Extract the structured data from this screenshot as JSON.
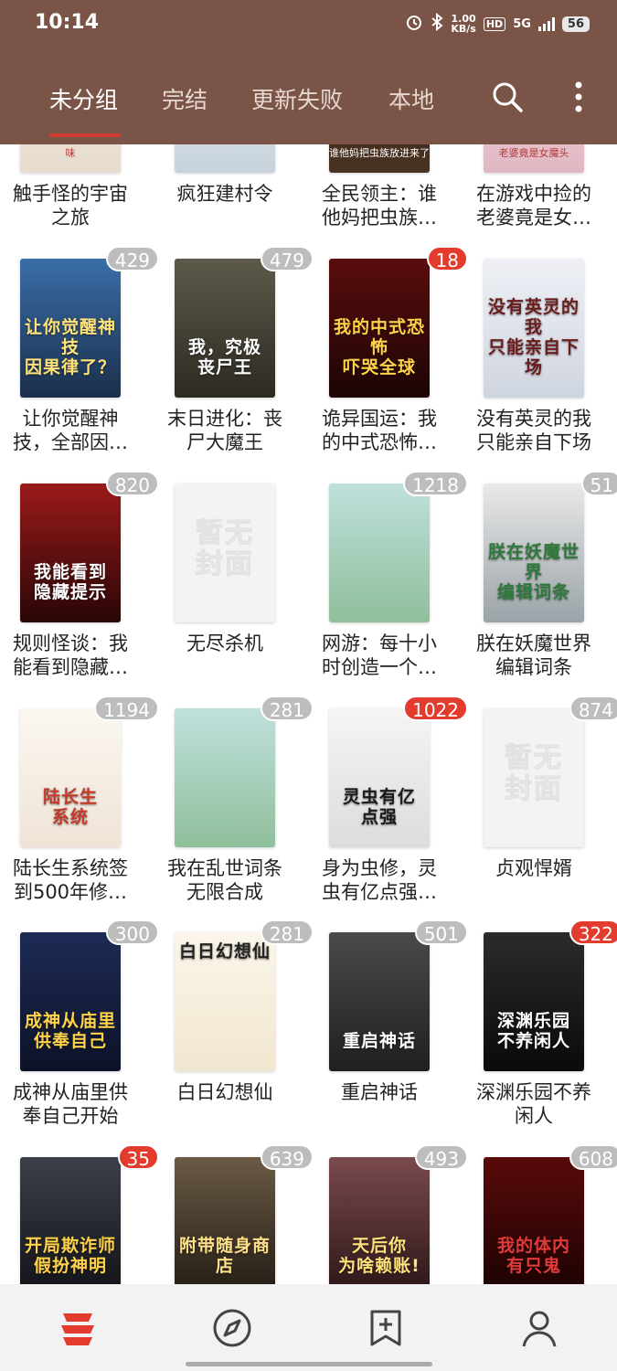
{
  "status": {
    "time": "10:14",
    "speed_top": "1.00",
    "speed_bottom": "KB/s",
    "hd": "HD",
    "network": "5G",
    "battery": "56"
  },
  "tabs": [
    {
      "label": "未分组",
      "active": true
    },
    {
      "label": "完结",
      "active": false
    },
    {
      "label": "更新失败",
      "active": false
    },
    {
      "label": "本地",
      "active": false
    }
  ],
  "header_icons": [
    "search-icon",
    "more-vertical-icon"
  ],
  "nocover_text": [
    "暂无",
    "封面"
  ],
  "books": [
    {
      "title": [
        "触手怪的宇宙",
        "之旅"
      ],
      "badge": null,
      "cover_small": "味",
      "colors": [
        "#f4ece3",
        "#e7dccd"
      ]
    },
    {
      "title": [
        "疯狂建村令"
      ],
      "badge": null,
      "colors": [
        "#e9edf1",
        "#c7d2dc"
      ]
    },
    {
      "title": [
        "全民领主：谁",
        "他妈把虫族…"
      ],
      "badge": null,
      "cover_small": "谁他妈把虫族放进来了",
      "colors": [
        "#2b1d14",
        "#4a3322"
      ]
    },
    {
      "title": [
        "在游戏中捡的",
        "老婆竟是女…"
      ],
      "badge": null,
      "cover_small": "老婆竟是女魔头",
      "colors": [
        "#f3e3e6",
        "#e0b7c2"
      ]
    },
    {
      "title": [
        "让你觉醒神",
        "技，全部因…"
      ],
      "badge": "429",
      "badge_red": false,
      "cover_text": [
        "让你觉醒神技",
        "因果律了？"
      ],
      "colors": [
        "#3a6ea8",
        "#1b2f4c"
      ],
      "text_color": "#ffe27a"
    },
    {
      "title": [
        "末日进化：丧",
        "尸大魔王"
      ],
      "badge": "479",
      "badge_red": false,
      "cover_text": [
        "我，究极",
        "丧尸王"
      ],
      "colors": [
        "#5d5a4a",
        "#2c2a22"
      ],
      "text_color": "#ffffff"
    },
    {
      "title": [
        "诡异国运：我",
        "的中式恐怖…"
      ],
      "badge": "18",
      "badge_red": true,
      "cover_text": [
        "我的中式恐怖",
        "吓哭全球"
      ],
      "colors": [
        "#5a0d0d",
        "#1c0505"
      ],
      "text_color": "#ffd24a"
    },
    {
      "title": [
        "没有英灵的我",
        "只能亲自下场"
      ],
      "badge": null,
      "cover_text": [
        "没有英灵的我",
        "只能亲自下场"
      ],
      "colors": [
        "#eef0f5",
        "#cfd5df"
      ],
      "text_color": "#6b1c1c"
    },
    {
      "title": [
        "规则怪谈：我",
        "能看到隐藏…"
      ],
      "badge": "820",
      "badge_red": false,
      "cover_text": [
        "我能看到",
        "隐藏提示"
      ],
      "colors": [
        "#9b1a1a",
        "#2a0606"
      ],
      "text_color": "#ffffff"
    },
    {
      "title": [
        "无尽杀机"
      ],
      "badge": null,
      "nocover": true,
      "colors": [
        "#f3f3f3",
        "#f3f3f3"
      ]
    },
    {
      "title": [
        "网游：每十小",
        "时创造一个…"
      ],
      "badge": "1218",
      "badge_red": false,
      "colors": [
        "#bfe0dc",
        "#8fbf9b"
      ]
    },
    {
      "title": [
        "朕在妖魔世界",
        "编辑词条"
      ],
      "badge": "51",
      "badge_red": false,
      "cover_text": [
        "朕在妖魔世界",
        "编辑词条"
      ],
      "colors": [
        "#e9e9e9",
        "#9aa3a8"
      ],
      "text_color": "#2e7a3a"
    },
    {
      "title": [
        "陆长生系统签",
        "到500年修…"
      ],
      "badge": "1194",
      "badge_red": false,
      "cover_text": [
        "陆长生",
        "系统"
      ],
      "colors": [
        "#fbf7f1",
        "#efe4d6"
      ],
      "text_color": "#c43a2a"
    },
    {
      "title": [
        "我在乱世词条",
        "无限合成"
      ],
      "badge": "281",
      "badge_red": false,
      "colors": [
        "#bfe0dc",
        "#8fbf9b"
      ]
    },
    {
      "title": [
        "身为虫修，灵",
        "虫有亿点强…"
      ],
      "badge": "1022",
      "badge_red": true,
      "cover_text": [
        "灵虫有亿",
        "点强"
      ],
      "colors": [
        "#f5f5f5",
        "#dcdcdc"
      ],
      "text_color": "#1a1a1a"
    },
    {
      "title": [
        "贞观悍婿"
      ],
      "badge": "874",
      "badge_red": false,
      "nocover": true,
      "colors": [
        "#f3f3f3",
        "#f3f3f3"
      ]
    },
    {
      "title": [
        "成神从庙里供",
        "奉自己开始"
      ],
      "badge": "300",
      "badge_red": false,
      "cover_text": [
        "成神从庙里",
        "供奉自己"
      ],
      "colors": [
        "#1d2b55",
        "#0c1228"
      ],
      "text_color": "#ffd34a"
    },
    {
      "title": [
        "白日幻想仙"
      ],
      "badge": "281",
      "badge_red": false,
      "cover_text": [
        "白日幻想仙"
      ],
      "colors": [
        "#fbf6ea",
        "#f1e6cf"
      ],
      "text_color": "#222222",
      "text_top": true
    },
    {
      "title": [
        "重启神话"
      ],
      "badge": "501",
      "badge_red": false,
      "cover_text": [
        "重启神话"
      ],
      "colors": [
        "#4a4a4a",
        "#1f1f1f"
      ],
      "text_color": "#ffffff"
    },
    {
      "title": [
        "深渊乐园不养",
        "闲人"
      ],
      "badge": "322",
      "badge_red": true,
      "cover_text": [
        "深渊乐园",
        "不养闲人"
      ],
      "colors": [
        "#2b2b2b",
        "#0a0a0a"
      ],
      "text_color": "#ffffff"
    },
    {
      "title": [
        ""
      ],
      "badge": "35",
      "badge_red": true,
      "cover_text": [
        "开局欺诈师",
        "假扮神明"
      ],
      "colors": [
        "#3b3f48",
        "#121318"
      ],
      "text_color": "#ffd24a"
    },
    {
      "title": [
        ""
      ],
      "badge": "639",
      "badge_red": false,
      "cover_text": [
        "附带随身商店"
      ],
      "colors": [
        "#6a5a45",
        "#221c14"
      ],
      "text_color": "#ffe08a"
    },
    {
      "title": [
        ""
      ],
      "badge": "493",
      "badge_red": false,
      "cover_text": [
        "天后你",
        "为啥赖账!"
      ],
      "colors": [
        "#7a4a4e",
        "#2a1517"
      ],
      "text_color": "#ffe27a"
    },
    {
      "title": [
        ""
      ],
      "badge": "608",
      "badge_red": false,
      "cover_text": [
        "我的体内",
        "有只鬼"
      ],
      "colors": [
        "#5a0a0a",
        "#1a0202"
      ],
      "text_color": "#e23a3a"
    }
  ],
  "bottom_nav": [
    "bookshelf-icon",
    "compass-icon",
    "bookmark-add-icon",
    "profile-icon"
  ]
}
